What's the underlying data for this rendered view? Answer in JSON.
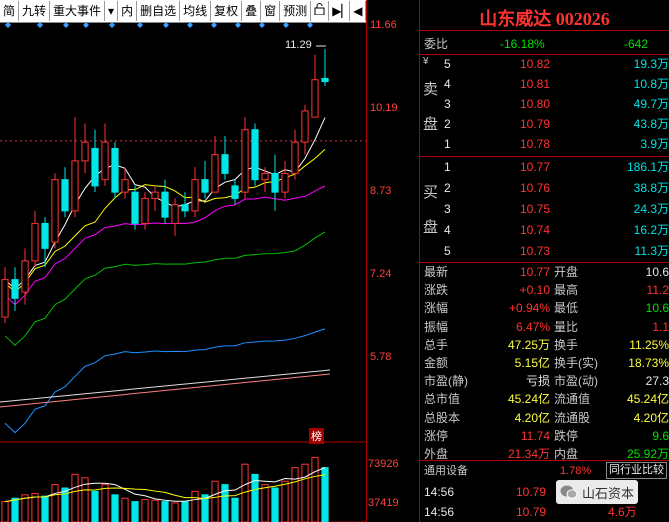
{
  "toolbar": {
    "items": [
      "简",
      "九转",
      "重大事件",
      "内",
      "删自选",
      "均线",
      "复权",
      "叠",
      "窗",
      "预测"
    ],
    "lock_icon": "lock-icon",
    "play_icon": "play-pause-icon",
    "collapse_icon": "collapse-arrow-icon"
  },
  "stock": {
    "title": "山东威达 002026"
  },
  "axis": {
    "price_labels": [
      "11.66",
      "10.19",
      "8.73",
      "7.24",
      "5.78"
    ],
    "volume_labels": [
      "73926",
      "37419"
    ]
  },
  "chart_data": {
    "type": "candlestick",
    "ylim": [
      5.0,
      11.66
    ],
    "annotations": {
      "high_marker": "11.29",
      "tag": "榜"
    },
    "candles": [
      {
        "o": 7.0,
        "c": 7.6,
        "h": 7.8,
        "l": 6.9
      },
      {
        "o": 7.6,
        "c": 7.3,
        "h": 7.8,
        "l": 7.1
      },
      {
        "o": 7.4,
        "c": 7.9,
        "h": 8.1,
        "l": 7.2
      },
      {
        "o": 7.9,
        "c": 8.5,
        "h": 8.7,
        "l": 7.8
      },
      {
        "o": 8.5,
        "c": 8.1,
        "h": 8.6,
        "l": 7.8
      },
      {
        "o": 8.2,
        "c": 9.2,
        "h": 9.3,
        "l": 8.1
      },
      {
        "o": 9.2,
        "c": 8.7,
        "h": 9.4,
        "l": 8.6
      },
      {
        "o": 8.7,
        "c": 9.5,
        "h": 10.2,
        "l": 8.6
      },
      {
        "o": 9.5,
        "c": 9.8,
        "h": 10.1,
        "l": 9.3
      },
      {
        "o": 9.7,
        "c": 9.1,
        "h": 10.0,
        "l": 9.0
      },
      {
        "o": 9.2,
        "c": 9.8,
        "h": 10.1,
        "l": 9.1
      },
      {
        "o": 9.7,
        "c": 9.0,
        "h": 9.8,
        "l": 8.9
      },
      {
        "o": 9.0,
        "c": 9.2,
        "h": 9.4,
        "l": 8.9
      },
      {
        "o": 9.0,
        "c": 8.5,
        "h": 9.1,
        "l": 8.4
      },
      {
        "o": 8.5,
        "c": 8.9,
        "h": 9.0,
        "l": 8.4
      },
      {
        "o": 8.9,
        "c": 9.0,
        "h": 9.1,
        "l": 8.7
      },
      {
        "o": 9.0,
        "c": 8.6,
        "h": 9.2,
        "l": 8.5
      },
      {
        "o": 8.5,
        "c": 8.8,
        "h": 8.9,
        "l": 8.3
      },
      {
        "o": 8.8,
        "c": 8.7,
        "h": 9.0,
        "l": 8.6
      },
      {
        "o": 8.7,
        "c": 9.2,
        "h": 9.4,
        "l": 8.6
      },
      {
        "o": 9.2,
        "c": 9.0,
        "h": 9.5,
        "l": 8.9
      },
      {
        "o": 9.0,
        "c": 9.6,
        "h": 9.9,
        "l": 9.0
      },
      {
        "o": 9.6,
        "c": 9.3,
        "h": 9.9,
        "l": 9.2
      },
      {
        "o": 9.1,
        "c": 8.9,
        "h": 9.2,
        "l": 8.8
      },
      {
        "o": 9.0,
        "c": 10.0,
        "h": 10.2,
        "l": 8.9
      },
      {
        "o": 10.0,
        "c": 9.2,
        "h": 10.1,
        "l": 9.1
      },
      {
        "o": 9.2,
        "c": 9.3,
        "h": 9.4,
        "l": 9.0
      },
      {
        "o": 9.3,
        "c": 9.0,
        "h": 9.6,
        "l": 8.7
      },
      {
        "o": 9.0,
        "c": 9.3,
        "h": 9.5,
        "l": 8.9
      },
      {
        "o": 9.3,
        "c": 9.8,
        "h": 10.0,
        "l": 9.2
      },
      {
        "o": 9.8,
        "c": 10.3,
        "h": 10.4,
        "l": 9.6
      },
      {
        "o": 10.2,
        "c": 10.8,
        "h": 11.2,
        "l": 10.2
      },
      {
        "o": 10.82,
        "c": 10.77,
        "h": 11.29,
        "l": 10.7
      }
    ],
    "volumes": [
      0.3,
      0.35,
      0.4,
      0.42,
      0.38,
      0.55,
      0.5,
      0.7,
      0.65,
      0.45,
      0.55,
      0.4,
      0.35,
      0.3,
      0.33,
      0.32,
      0.3,
      0.28,
      0.3,
      0.45,
      0.4,
      0.6,
      0.55,
      0.35,
      0.85,
      0.7,
      0.55,
      0.5,
      0.6,
      0.8,
      0.85,
      0.95,
      0.8
    ]
  },
  "panel": {
    "weibi": {
      "label": "委比",
      "pct": "-16.18%",
      "diff": "-642"
    },
    "sell_label": [
      "卖",
      "盘"
    ],
    "buy_label": [
      "买",
      "盘"
    ],
    "yen": "¥",
    "sell": [
      {
        "n": "5",
        "price": "10.82",
        "vol": "19.3万"
      },
      {
        "n": "4",
        "price": "10.81",
        "vol": "10.8万"
      },
      {
        "n": "3",
        "price": "10.80",
        "vol": "49.7万"
      },
      {
        "n": "2",
        "price": "10.79",
        "vol": "43.8万"
      },
      {
        "n": "1",
        "price": "10.78",
        "vol": "3.9万"
      }
    ],
    "buy": [
      {
        "n": "1",
        "price": "10.77",
        "vol": "186.1万"
      },
      {
        "n": "2",
        "price": "10.76",
        "vol": "38.8万"
      },
      {
        "n": "3",
        "price": "10.75",
        "vol": "24.3万"
      },
      {
        "n": "4",
        "price": "10.74",
        "vol": "16.2万"
      },
      {
        "n": "5",
        "price": "10.73",
        "vol": "11.3万"
      }
    ],
    "stats": [
      {
        "l1": "最新",
        "v1": "10.77",
        "c1": "red",
        "l2": "开盘",
        "v2": "10.6",
        "c2": "white"
      },
      {
        "l1": "涨跌",
        "v1": "+0.10",
        "c1": "red",
        "l2": "最高",
        "v2": "11.2",
        "c2": "red"
      },
      {
        "l1": "涨幅",
        "v1": "+0.94%",
        "c1": "red",
        "l2": "最低",
        "v2": "10.6",
        "c2": "green"
      },
      {
        "l1": "振幅",
        "v1": "6.47%",
        "c1": "red",
        "l2": "量比",
        "v2": "1.1",
        "c2": "red"
      },
      {
        "l1": "总手",
        "v1": "47.25万",
        "c1": "yellow",
        "l2": "换手",
        "v2": "11.25%",
        "c2": "yellow"
      },
      {
        "l1": "金额",
        "v1": "5.15亿",
        "c1": "yellow",
        "l2": "换手(实)",
        "v2": "18.73%",
        "c2": "yellow"
      },
      {
        "l1": "市盈(静)",
        "v1": "亏损",
        "c1": "white",
        "l2": "市盈(动)",
        "v2": "27.3",
        "c2": "white"
      },
      {
        "l1": "总市值",
        "v1": "45.24亿",
        "c1": "yellow",
        "l2": "流通值",
        "v2": "45.24亿",
        "c2": "yellow"
      },
      {
        "l1": "总股本",
        "v1": "4.20亿",
        "c1": "yellow",
        "l2": "流通股",
        "v2": "4.20亿",
        "c2": "yellow"
      },
      {
        "l1": "涨停",
        "v1": "11.74",
        "c1": "red",
        "l2": "跌停",
        "v2": "9.6",
        "c2": "green"
      },
      {
        "l1": "外盘",
        "v1": "21.34万",
        "c1": "red",
        "l2": "内盘",
        "v2": "25.92万",
        "c2": "green"
      }
    ],
    "sector": {
      "name": "通用设备",
      "pct": "1.78%",
      "compare": "同行业比较"
    },
    "ticks": [
      {
        "time": "14:56",
        "price": "10.79",
        "vol": ""
      },
      {
        "time": "14:56",
        "price": "10.79",
        "vol": "4.6万"
      }
    ],
    "watermark": "山石资本",
    "wechat_icon": "wechat-icon"
  },
  "colors": {
    "up": "#ff3232",
    "down": "#00e5e5",
    "ma5": "#ffffff",
    "ma10": "#ffff00",
    "ma20": "#ff00ff",
    "ma30": "#00c000",
    "ma60": "#1e90ff"
  }
}
